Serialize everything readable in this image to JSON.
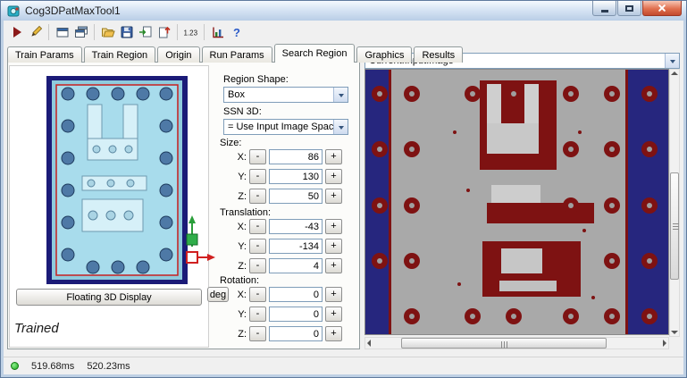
{
  "window": {
    "title": "Cog3DPatMaxTool1"
  },
  "toolbar": {
    "icons": [
      "run",
      "edit-pencil",
      "current-record-window",
      "copy-window",
      "open-file",
      "save-file",
      "import-tool",
      "export-tool",
      "number-format",
      "results-chart",
      "help"
    ],
    "number_format_text": "1.23",
    "help_glyph": "?"
  },
  "tabs": {
    "items": [
      "Train Params",
      "Train Region",
      "Origin",
      "Run Params",
      "Search Region",
      "Graphics",
      "Results"
    ],
    "active": "Search Region"
  },
  "left_panel": {
    "floating_button_label": "Floating 3D Display",
    "trained_label": "Trained"
  },
  "controls": {
    "region_shape_label": "Region Shape:",
    "region_shape_value": "Box",
    "ssn_label": "SSN 3D:",
    "ssn_value": "= Use Input Image Space",
    "size_label": "Size:",
    "translation_label": "Translation:",
    "rotation_label": "Rotation:",
    "deg_label": "deg",
    "axis_x": "X:",
    "axis_y": "Y:",
    "axis_z": "Z:",
    "minus_label": "-",
    "plus_label": "+",
    "size": {
      "x": "86",
      "y": "130",
      "z": "50"
    },
    "translation": {
      "x": "-43",
      "y": "-134",
      "z": "4"
    },
    "rotation": {
      "x": "0",
      "y": "0",
      "z": "0"
    }
  },
  "right_panel": {
    "image_selector_value": "Current.InputImage"
  },
  "statusbar": {
    "time1": "519.68ms",
    "time2": "520.23ms"
  },
  "colors": {
    "viewport_bg": "#1b1b78",
    "part_fill": "#a8dcec",
    "region_outline": "#cc2222",
    "image_bg": "#a9a9a9",
    "image_stripe": "#26267e",
    "image_feature": "#7e1212",
    "status_ok": "#1da81d"
  }
}
